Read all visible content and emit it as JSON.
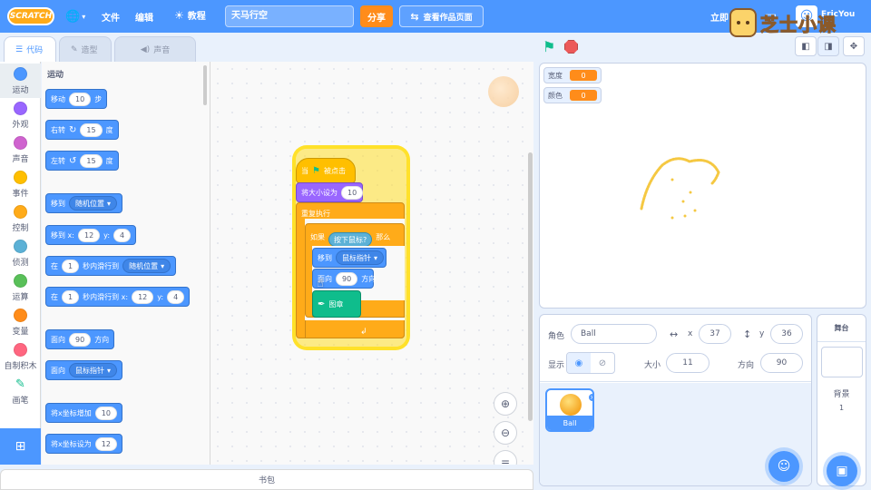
{
  "menubar": {
    "logo": "SCRATCH",
    "file": "文件",
    "edit": "编辑",
    "tutorials": "教程",
    "project_title": "天马行空",
    "share": "分享",
    "see_project_page": "查看作品页面",
    "save_now": "立即",
    "user": "EricYou",
    "watermark": "芝士小课"
  },
  "tabs": {
    "code": "代码",
    "costumes": "造型",
    "sounds": "声音"
  },
  "categories": [
    {
      "label": "运动",
      "color": "#4c97ff"
    },
    {
      "label": "外观",
      "color": "#9966ff"
    },
    {
      "label": "声音",
      "color": "#cf63cf"
    },
    {
      "label": "事件",
      "color": "#ffbf00"
    },
    {
      "label": "控制",
      "color": "#ffab19"
    },
    {
      "label": "侦测",
      "color": "#5cb1d6"
    },
    {
      "label": "运算",
      "color": "#59c059"
    },
    {
      "label": "变量",
      "color": "#ff8c1a"
    },
    {
      "label": "自制积木",
      "color": "#ff6680"
    },
    {
      "label": "画笔",
      "color": "#0fbd8c"
    }
  ],
  "palette": {
    "heading": "运动",
    "move": {
      "label": "移动",
      "value": "10",
      "suffix": "步"
    },
    "turn_right": {
      "label": "右转",
      "value": "15",
      "suffix": "度"
    },
    "turn_left": {
      "label": "左转",
      "value": "15",
      "suffix": "度"
    },
    "goto": {
      "label": "移到",
      "dropdown": "随机位置"
    },
    "goto_xy": {
      "label": "移到 x:",
      "x": "12",
      "ylabel": "y:",
      "y": "4"
    },
    "glide_to": {
      "label": "在",
      "value": "1",
      "mid": "秒内滑行到",
      "dropdown": "随机位置"
    },
    "glide_xy": {
      "label": "在",
      "value": "1",
      "mid": "秒内滑行到 x:",
      "x": "12",
      "ylabel": "y:",
      "y": "4"
    },
    "point_dir": {
      "label": "面向",
      "value": "90",
      "suffix": "方向"
    },
    "point_towards": {
      "label": "面向",
      "dropdown": "鼠标指针"
    },
    "change_x": {
      "label": "将x坐标增加",
      "value": "10"
    },
    "set_x": {
      "label": "将x坐标设为",
      "value": "12"
    }
  },
  "script": {
    "when_flag": {
      "label": "当",
      "suffix": "被点击"
    },
    "set_size": {
      "label": "将大小设为",
      "value": "10"
    },
    "forever": "重复执行",
    "if": {
      "label": "如果",
      "cond": "按下鼠标?",
      "then": "那么"
    },
    "goto_mouse": {
      "label": "移到",
      "dropdown": "鼠标指针"
    },
    "point_dir": {
      "label": "面向",
      "value": "90",
      "suffix": "方向"
    },
    "stamp": "图章"
  },
  "stage": {
    "monitors": [
      {
        "label": "宽度",
        "value": "0"
      },
      {
        "label": "颜色",
        "value": "0"
      }
    ]
  },
  "sprite_info": {
    "sprite_label": "角色",
    "sprite_name": "Ball",
    "x_label": "x",
    "x": "37",
    "y_label": "y",
    "y": "36",
    "show_label": "显示",
    "size_label": "大小",
    "size": "11",
    "direction_label": "方向",
    "direction": "90"
  },
  "sprite_list": [
    {
      "name": "Ball"
    }
  ],
  "stage_pane": {
    "title": "舞台",
    "backdrop_label": "背景",
    "backdrop_count": "1"
  },
  "backpack": "书包"
}
